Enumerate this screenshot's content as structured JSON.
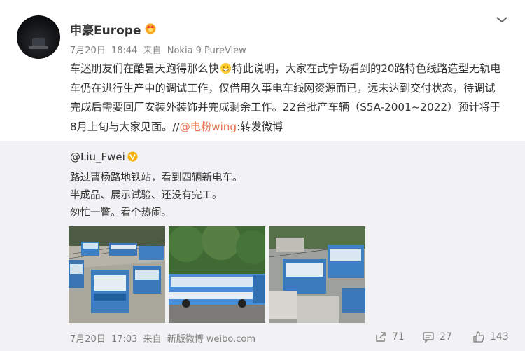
{
  "post": {
    "username": "申豪Europe",
    "date": "7月20日",
    "time": "18:44",
    "via_prefix": "来自",
    "device": "Nokia 9 PureView",
    "text_part1": "车迷朋友们在酷暑天跑得那么快",
    "text_part2": "特此说明，大家在武宁场看到的20路特色线路造型无轨电车仍在进行生产中的调试工作，仅借用久事电车线网资源而已，远未达到交付状态，待调试完成后需要回厂安装外装饰并完成剩余工作。22台批产车辆（S5A-2001~2022）预计将于8月上旬与大家见面。//",
    "mention": "@电粉wing",
    "text_part3": ":转发微博"
  },
  "repost": {
    "username": "@Liu_Fwei",
    "line1": "路过曹杨路地铁站，看到四辆新电车。",
    "line2": "半成品、展示试验、还没有完工。",
    "line3": "匆忙一瞥。看个热闹。",
    "date": "7月20日",
    "time": "17:03",
    "via_prefix": "来自",
    "source": "新版微博 weibo.com"
  },
  "actions": {
    "reposts": "71",
    "comments": "27",
    "likes": "143"
  },
  "icons": [
    "user-avatar",
    "crown-badge-icon",
    "chevron-down-icon",
    "grin-emoji-icon",
    "verified-v-icon",
    "share-icon",
    "comment-icon",
    "thumbs-up-icon"
  ],
  "colors": {
    "mention": "#eb7350",
    "repost_bg": "#f2f2f5",
    "meta": "#808080",
    "vbadge": "#f7b000"
  }
}
